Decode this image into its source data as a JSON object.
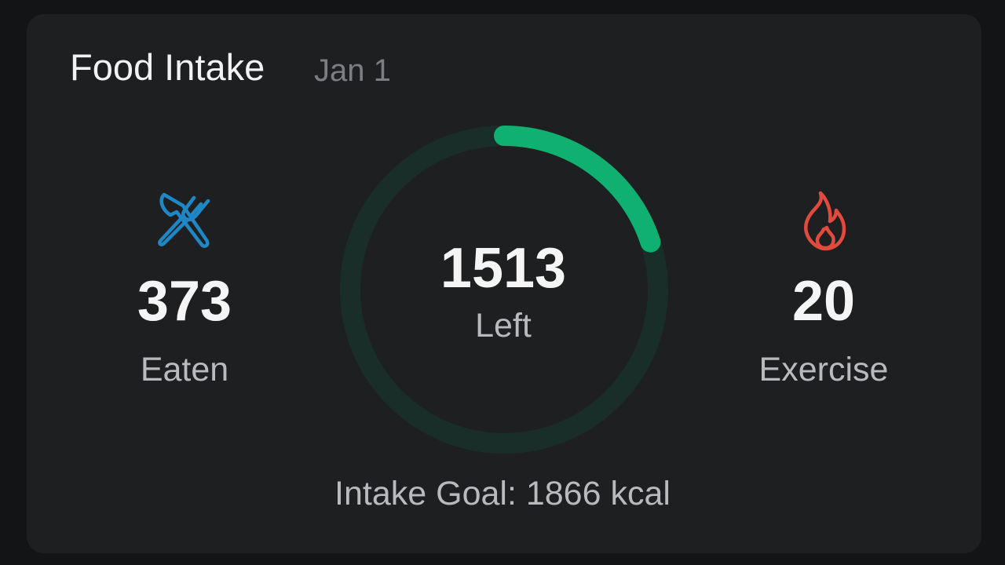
{
  "card": {
    "title": "Food Intake",
    "date": "Jan 1"
  },
  "eaten": {
    "icon": "fork-knife-icon",
    "value": "373",
    "label": "Eaten",
    "color": "#1e88c7"
  },
  "remaining": {
    "value": "1513",
    "label": "Left",
    "progress_fraction": 0.2,
    "ring_color": "#0fb070",
    "track_color": "#1a2e29"
  },
  "exercise": {
    "icon": "flame-icon",
    "value": "20",
    "label": "Exercise",
    "color": "#e04a3f"
  },
  "goal": {
    "text": "Intake Goal: 1866 kcal"
  }
}
